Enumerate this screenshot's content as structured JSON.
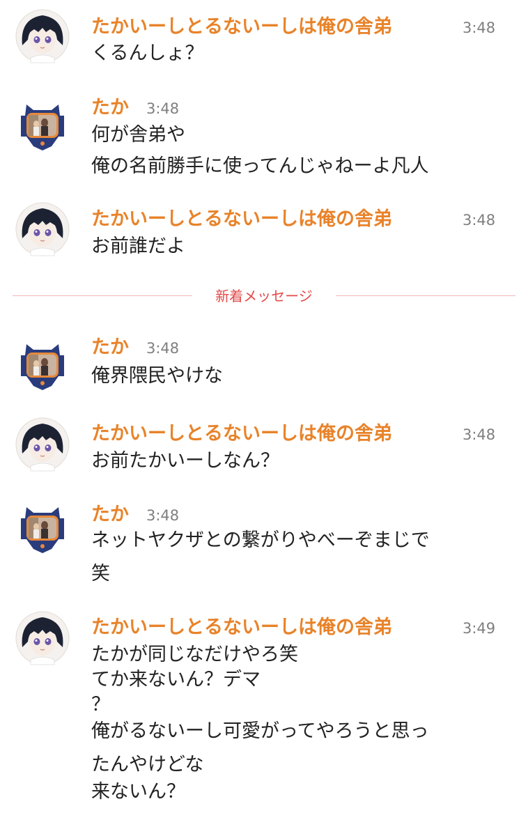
{
  "users": {
    "sender_a": "たかいーしとるないーしは俺の舎弟",
    "sender_b": "たか"
  },
  "divider": {
    "label": "新着メッセージ"
  },
  "messages": [
    {
      "sender": "たかいーしとるないーしは俺の舎弟",
      "time": "3:48",
      "lines": [
        "くるんしょ？"
      ]
    },
    {
      "sender": "たか",
      "time": "3:48",
      "lines": [
        "何が舎弟や",
        "俺の名前勝手に使ってんじゃねーよ凡人"
      ]
    },
    {
      "sender": "たかいーしとるないーしは俺の舎弟",
      "time": "3:48",
      "lines": [
        "お前誰だよ"
      ]
    },
    {
      "sender": "たか",
      "time": "3:48",
      "lines": [
        "俺界隈民やけな"
      ]
    },
    {
      "sender": "たかいーしとるないーしは俺の舎弟",
      "time": "3:48",
      "lines": [
        "お前たかいーしなん？"
      ]
    },
    {
      "sender": "たか",
      "time": "3:48",
      "lines": [
        "ネットヤクザとの繋がりやべーぞまじで",
        "笑"
      ]
    },
    {
      "sender": "たかいーしとるないーしは俺の舎弟",
      "time": "3:49",
      "lines": [
        "たかが同じなだけやろ笑",
        "てか来ないん？デマ",
        "？",
        "俺がるないーし可愛がってやろうと思っ",
        "たんやけどな",
        "来ないん？"
      ]
    }
  ]
}
